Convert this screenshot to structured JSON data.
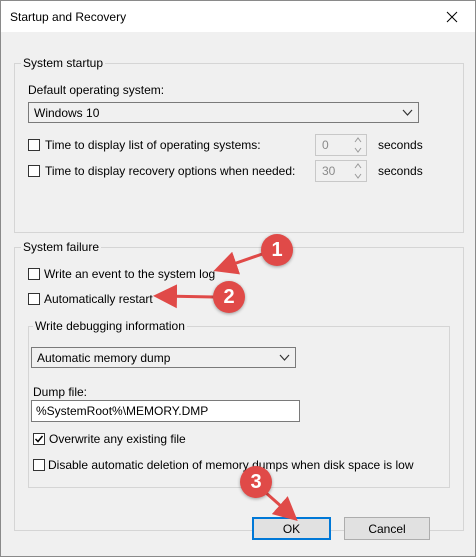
{
  "window": {
    "title": "Startup and Recovery"
  },
  "system_startup": {
    "group_title": "System startup",
    "default_os_label": "Default operating system:",
    "default_os_value": "Windows 10",
    "list_label": "Time to display list of operating systems:",
    "list_value": "0",
    "list_unit": "seconds",
    "recovery_label": "Time to display recovery options when needed:",
    "recovery_value": "30",
    "recovery_unit": "seconds"
  },
  "system_failure": {
    "group_title": "System failure",
    "write_event_label": "Write an event to the system log",
    "auto_restart_label": "Automatically restart",
    "debug_group_title": "Write debugging information",
    "dump_type_value": "Automatic memory dump",
    "dump_file_label": "Dump file:",
    "dump_file_value": "%SystemRoot%\\MEMORY.DMP",
    "overwrite_label": "Overwrite any existing file",
    "overwrite_checked": true,
    "disable_deletion_label": "Disable automatic deletion of memory dumps when disk space is low"
  },
  "buttons": {
    "ok": "OK",
    "cancel": "Cancel"
  },
  "annotations": {
    "step1": "1",
    "step2": "2",
    "step3": "3",
    "color": "#e04a48"
  }
}
